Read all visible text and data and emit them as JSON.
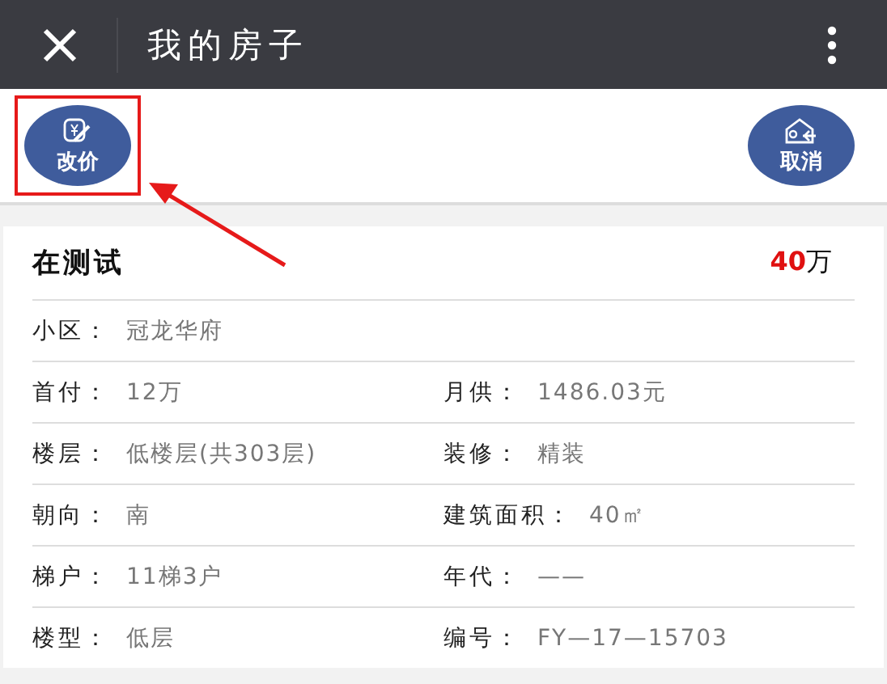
{
  "header": {
    "title": "我的房子"
  },
  "actions": [
    {
      "label": "改价",
      "kind": "price",
      "highlighted": true
    },
    {
      "label": "取消",
      "kind": "cancel",
      "highlighted": false
    }
  ],
  "listing": {
    "name": "在测试",
    "price": "40",
    "unit": "万"
  },
  "rows": [
    [
      {
        "label": "小区：",
        "value": "冠龙华府"
      }
    ],
    [
      {
        "label": "首付：",
        "value": "12万"
      },
      {
        "label": "月供：",
        "value": "1486.03元"
      }
    ],
    [
      {
        "label": "楼层：",
        "value": "低楼层(共303层)"
      },
      {
        "label": "装修：",
        "value": "精装"
      }
    ],
    [
      {
        "label": "朝向：",
        "value": "南"
      },
      {
        "label": "建筑面积：",
        "value": "40㎡"
      }
    ],
    [
      {
        "label": "梯户：",
        "value": "11梯3户"
      },
      {
        "label": "年代：",
        "value": "——"
      }
    ],
    [
      {
        "label": "楼型：",
        "value": "低层"
      },
      {
        "label": "编号：",
        "value": "FY—17—15703"
      }
    ]
  ]
}
